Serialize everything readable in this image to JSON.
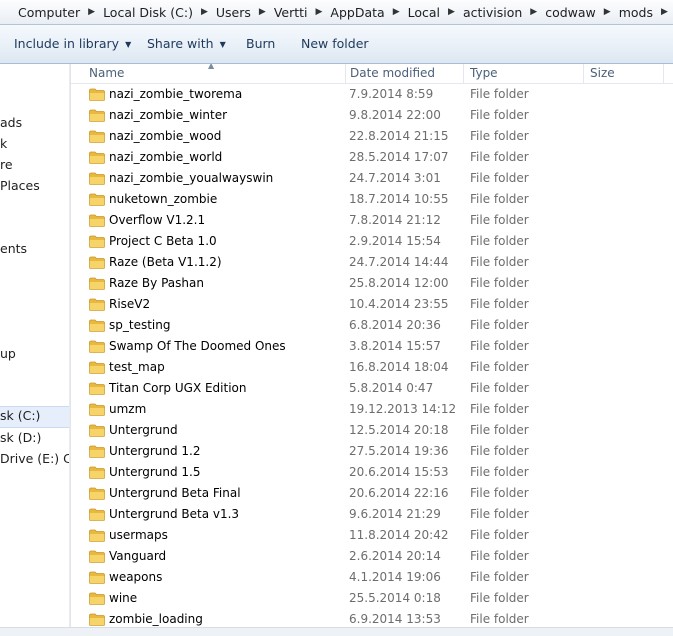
{
  "breadcrumb": [
    "Computer",
    "Local Disk (C:)",
    "Users",
    "Vertti",
    "AppData",
    "Local",
    "activision",
    "codwaw",
    "mods"
  ],
  "toolbar": {
    "include_label": "Include in library",
    "share_label": "Share with",
    "burn_label": "Burn",
    "new_folder_label": "New folder"
  },
  "nav": {
    "items": [
      "ads",
      "k",
      "re",
      "Places",
      "ents",
      "up",
      "sk (C:)",
      "sk (D:)",
      "Drive (E:) CC"
    ]
  },
  "columns": {
    "name": "Name",
    "date": "Date modified",
    "type": "Type",
    "size": "Size"
  },
  "files": [
    {
      "name": "nazi_zombie_tworema",
      "date": "7.9.2014 8:59",
      "type": "File folder"
    },
    {
      "name": "nazi_zombie_winter",
      "date": "9.8.2014 22:00",
      "type": "File folder"
    },
    {
      "name": "nazi_zombie_wood",
      "date": "22.8.2014 21:15",
      "type": "File folder"
    },
    {
      "name": "nazi_zombie_world",
      "date": "28.5.2014 17:07",
      "type": "File folder"
    },
    {
      "name": "nazi_zombie_youalwayswin",
      "date": "24.7.2014 3:01",
      "type": "File folder"
    },
    {
      "name": "nuketown_zombie",
      "date": "18.7.2014 10:55",
      "type": "File folder"
    },
    {
      "name": "Overflow V1.2.1",
      "date": "7.8.2014 21:12",
      "type": "File folder"
    },
    {
      "name": "Project C Beta 1.0",
      "date": "2.9.2014 15:54",
      "type": "File folder"
    },
    {
      "name": "Raze (Beta V1.1.2)",
      "date": "24.7.2014 14:44",
      "type": "File folder"
    },
    {
      "name": "Raze By Pashan",
      "date": "25.8.2014 12:00",
      "type": "File folder"
    },
    {
      "name": "RiseV2",
      "date": "10.4.2014 23:55",
      "type": "File folder"
    },
    {
      "name": "sp_testing",
      "date": "6.8.2014 20:36",
      "type": "File folder"
    },
    {
      "name": "Swamp Of The Doomed Ones",
      "date": "3.8.2014 15:57",
      "type": "File folder"
    },
    {
      "name": "test_map",
      "date": "16.8.2014 18:04",
      "type": "File folder"
    },
    {
      "name": "Titan Corp UGX Edition",
      "date": "5.8.2014 0:47",
      "type": "File folder"
    },
    {
      "name": "umzm",
      "date": "19.12.2013 14:12",
      "type": "File folder"
    },
    {
      "name": "Untergrund",
      "date": "12.5.2014 20:18",
      "type": "File folder"
    },
    {
      "name": "Untergrund 1.2",
      "date": "27.5.2014 19:36",
      "type": "File folder"
    },
    {
      "name": "Untergrund 1.5",
      "date": "20.6.2014 15:53",
      "type": "File folder"
    },
    {
      "name": "Untergrund Beta Final",
      "date": "20.6.2014 22:16",
      "type": "File folder"
    },
    {
      "name": "Untergrund Beta v1.3",
      "date": "9.6.2014 21:29",
      "type": "File folder"
    },
    {
      "name": "usermaps",
      "date": "11.8.2014 20:42",
      "type": "File folder"
    },
    {
      "name": "Vanguard",
      "date": "2.6.2014 20:14",
      "type": "File folder"
    },
    {
      "name": "weapons",
      "date": "4.1.2014 19:06",
      "type": "File folder"
    },
    {
      "name": "wine",
      "date": "25.5.2014 0:18",
      "type": "File folder"
    },
    {
      "name": "zombie_loading",
      "date": "6.9.2014 13:53",
      "type": "File folder"
    }
  ]
}
